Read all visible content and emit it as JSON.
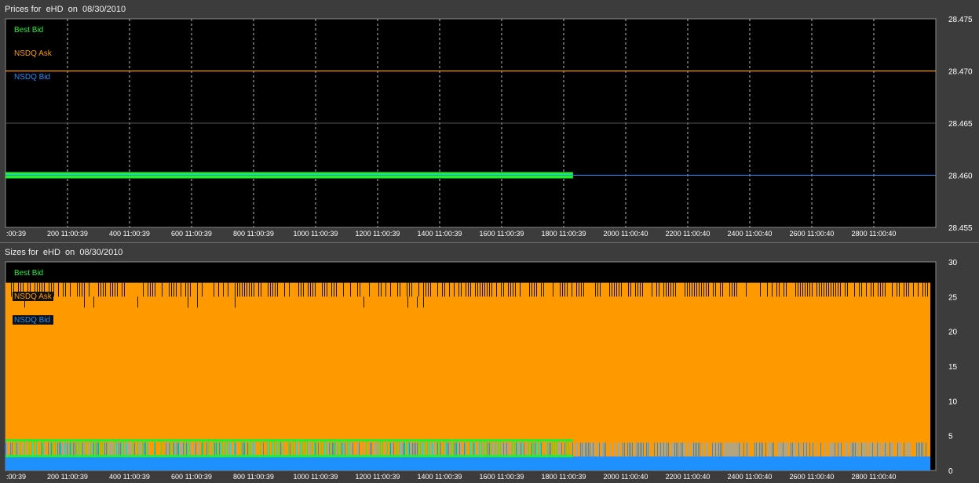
{
  "colors": {
    "best_bid": "#22ee33",
    "nsdq_ask": "#ff9900",
    "nsdq_bid": "#1e90ff",
    "plot_bg": "#000000",
    "grid": "#bbbbbb",
    "frame_bg": "#3c3c3c"
  },
  "chart_data": [
    {
      "type": "line",
      "title": "Prices for  eHD  on  08/30/2010",
      "x_tick_labels": [
        ":00:39",
        "200 11:00:39",
        "400 11:00:39",
        "600 11:00:39",
        "800 11:00:39",
        "1000 11:00:39",
        "1200 11:00:39",
        "1400 11:00:39",
        "1600 11:00:39",
        "1800 11:00:39",
        "2000 11:00:40",
        "2200 11:00:40",
        "2400 11:00:40",
        "2600 11:00:40",
        "2800 11:00:40"
      ],
      "x_ticks": [
        0,
        200,
        400,
        600,
        800,
        1000,
        1200,
        1400,
        1600,
        1800,
        2000,
        2200,
        2400,
        2600,
        2800
      ],
      "xlim": [
        0,
        3000
      ],
      "ylim": [
        28.455,
        28.475
      ],
      "y_ticks": [
        "28.455",
        "28.460",
        "28.465",
        "28.470",
        "28.475"
      ],
      "legend_position": "top-left",
      "grid": true,
      "series": [
        {
          "name": "Best Bid",
          "x": [
            0,
            1830
          ],
          "y": [
            28.46,
            28.46
          ]
        },
        {
          "name": "NSDQ Ask",
          "x": [
            0,
            3000
          ],
          "y": [
            28.47,
            28.47
          ]
        },
        {
          "name": "NSDQ Bid",
          "x": [
            0,
            3000
          ],
          "y": [
            28.46,
            28.46
          ]
        }
      ]
    },
    {
      "type": "area",
      "title": "Sizes for  eHD  on  08/30/2010",
      "x_tick_labels": [
        ":00:39",
        "200 11:00:39",
        "400 11:00:39",
        "600 11:00:39",
        "800 11:00:39",
        "1000 11:00:39",
        "1200 11:00:39",
        "1400 11:00:39",
        "1600 11:00:39",
        "1800 11:00:39",
        "2000 11:00:40",
        "2200 11:00:40",
        "2400 11:00:40",
        "2600 11:00:40",
        "2800 11:00:40"
      ],
      "x_ticks": [
        0,
        200,
        400,
        600,
        800,
        1000,
        1200,
        1400,
        1600,
        1800,
        2000,
        2200,
        2400,
        2600,
        2800
      ],
      "xlim": [
        0,
        3000
      ],
      "ylim": [
        0,
        30
      ],
      "y_ticks": [
        "0",
        "5",
        "10",
        "15",
        "20",
        "25",
        "30"
      ],
      "legend_position": "top-left",
      "grid": false,
      "series": [
        {
          "name": "Best Bid",
          "x": [
            0,
            1830
          ],
          "y": [
            4.5,
            4.5
          ],
          "range": [
            2,
            4.5
          ]
        },
        {
          "name": "NSDQ Ask",
          "x": [
            0,
            3000
          ],
          "y": [
            27,
            27
          ],
          "typical": 25
        },
        {
          "name": "NSDQ Bid",
          "x": [
            0,
            3000
          ],
          "y": [
            4,
            4
          ],
          "typical": 2
        }
      ]
    }
  ]
}
